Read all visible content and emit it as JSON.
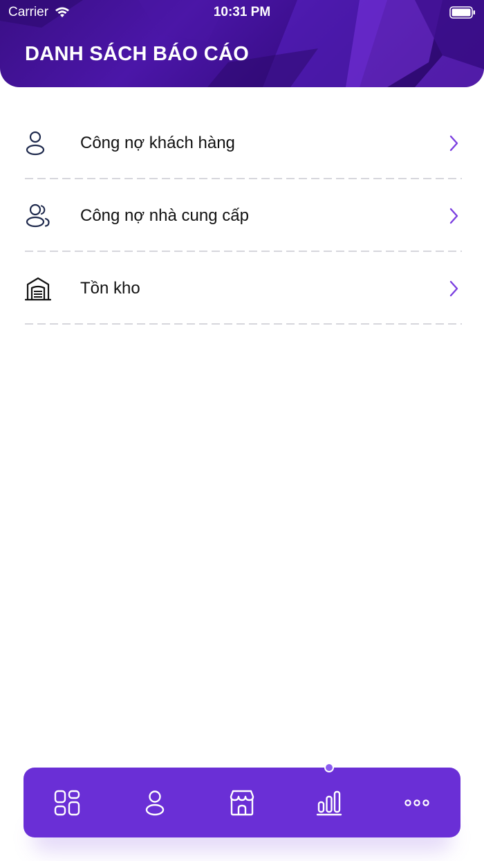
{
  "status_bar": {
    "carrier": "Carrier",
    "time": "10:31 PM"
  },
  "header": {
    "title": "DANH SÁCH BÁO CÁO"
  },
  "reports": [
    {
      "label": "Công nợ khách hàng",
      "icon": "user-icon"
    },
    {
      "label": "Công nợ nhà cung cấp",
      "icon": "users-icon"
    },
    {
      "label": "Tồn kho",
      "icon": "warehouse-icon"
    }
  ],
  "tabbar": {
    "tabs": [
      {
        "icon": "grid-icon"
      },
      {
        "icon": "user-icon"
      },
      {
        "icon": "store-icon"
      },
      {
        "icon": "bar-chart-icon",
        "active": true
      },
      {
        "icon": "more-icon"
      }
    ]
  },
  "colors": {
    "header_gradient": [
      "#3a0f86",
      "#2a0868"
    ],
    "accent": "#6a2fd6",
    "chevron": "#7b3fe0",
    "item_icon": "#1f2a4d"
  }
}
